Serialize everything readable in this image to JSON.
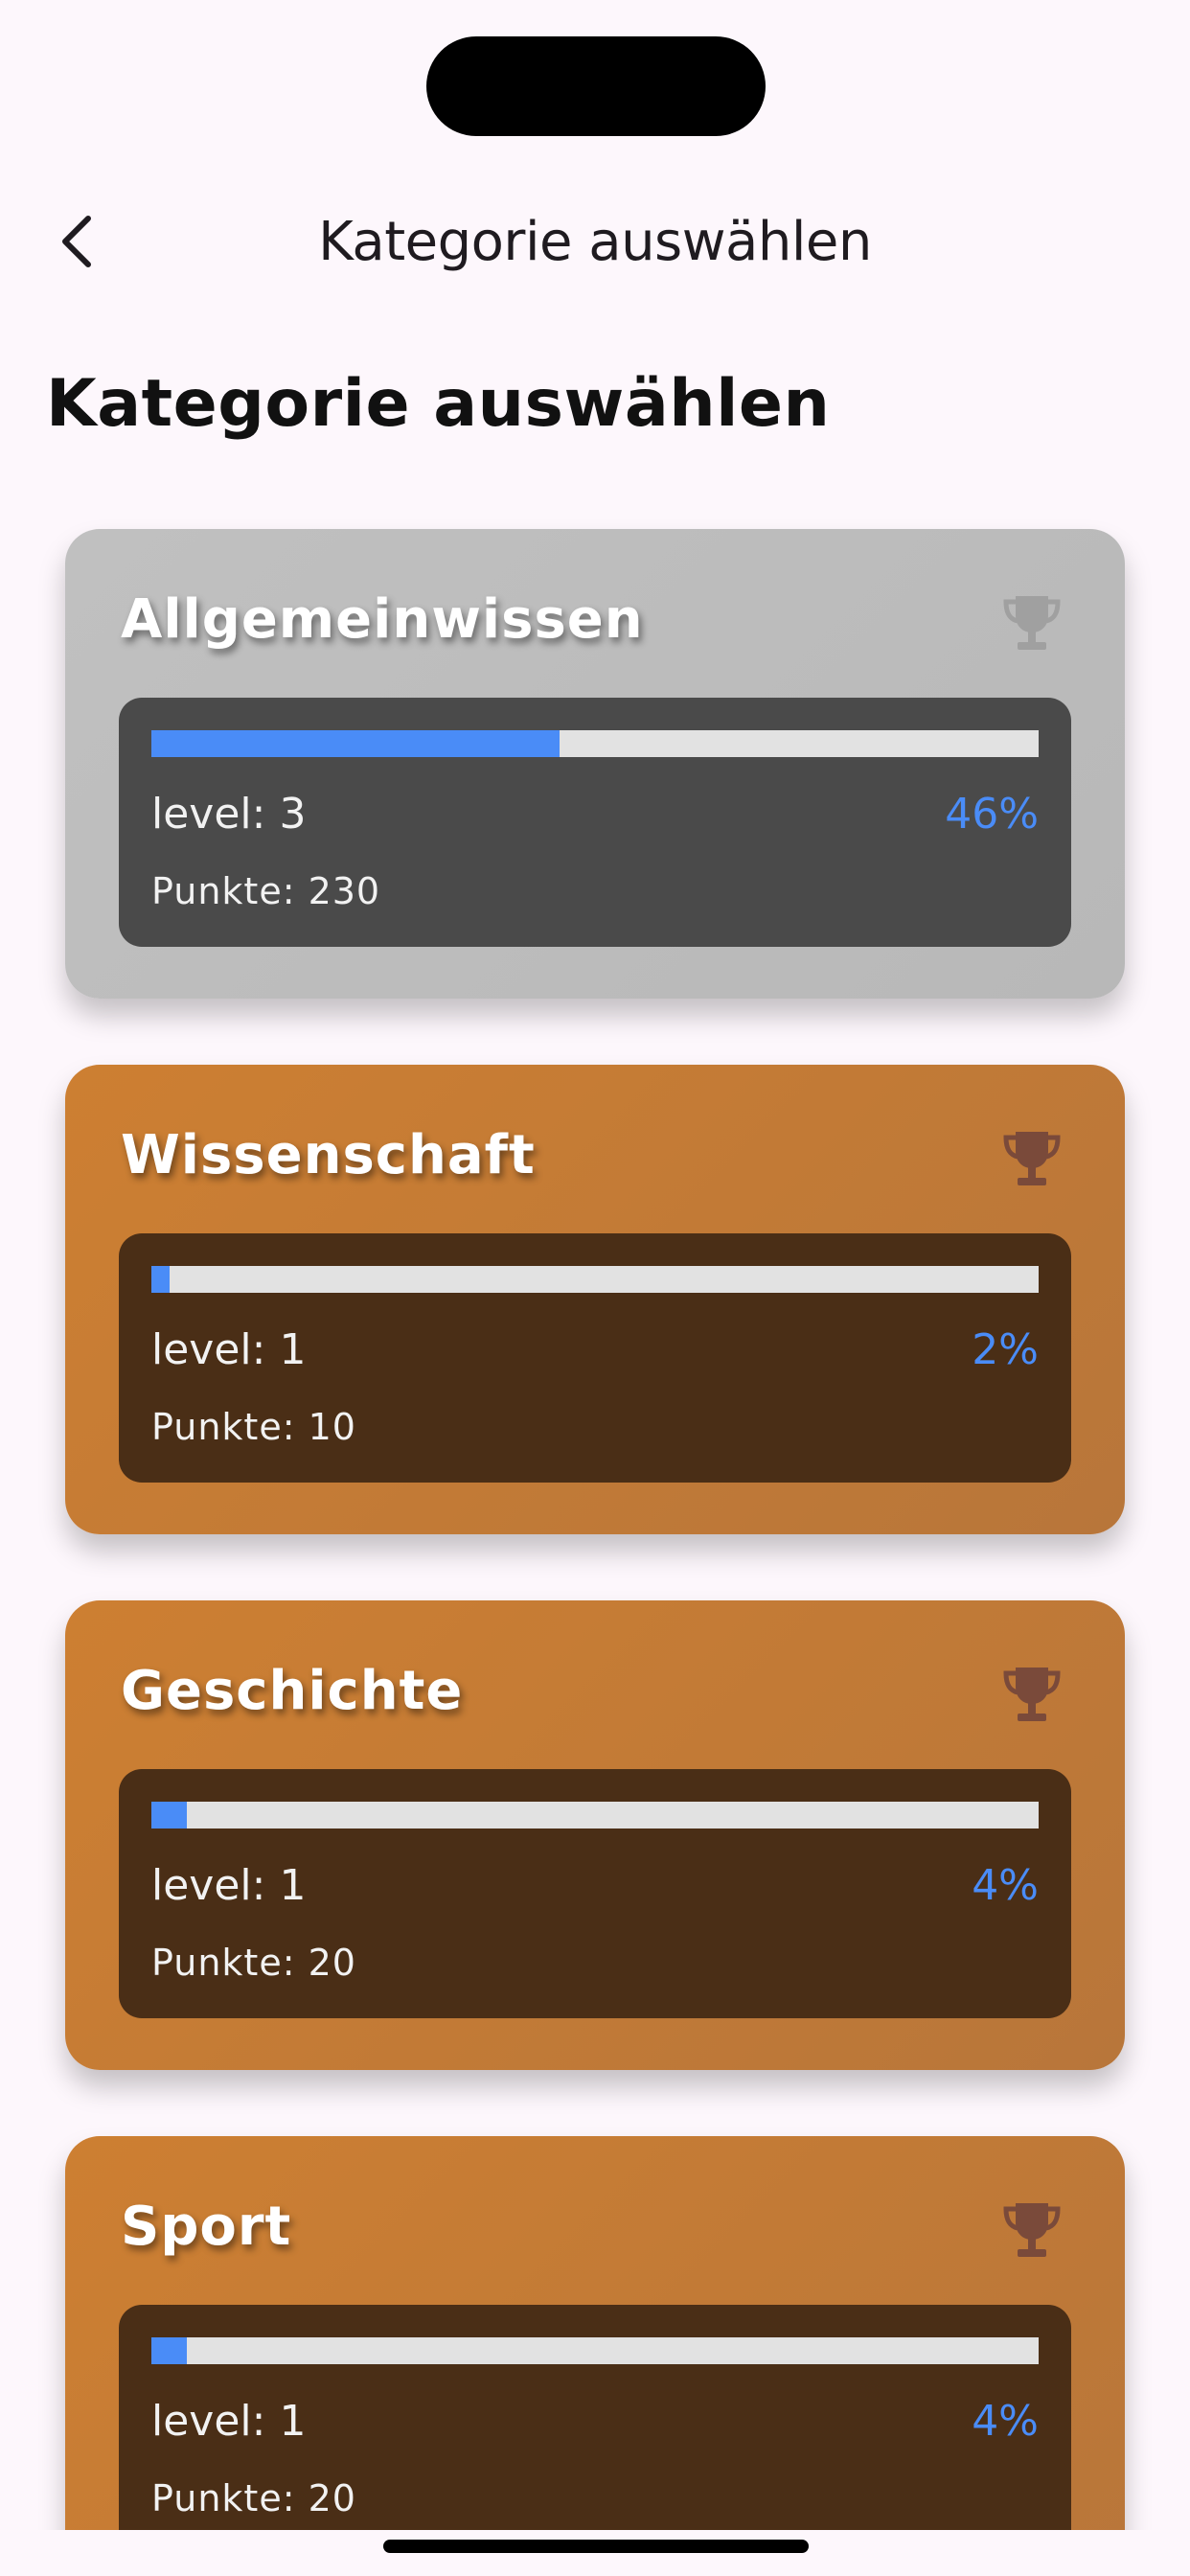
{
  "header": {
    "back_icon": "chevron-left-icon",
    "title": "Kategorie auswählen"
  },
  "page": {
    "title": "Kategorie auswählen"
  },
  "colors": {
    "background": "#fdf7fc",
    "silver_card": "#c0c0c0",
    "bronze_card": "#cd7f32",
    "progress_fill": "#4a8cf7",
    "progress_track": "#e2e2e2"
  },
  "categories": [
    {
      "name": "Allgemeinwissen",
      "tier": "silver",
      "trophy_icon": "trophy-icon",
      "progress": 0.46,
      "level": "level: 3",
      "percent": "46%",
      "points": "Punkte: 230"
    },
    {
      "name": "Wissenschaft",
      "tier": "bronze",
      "trophy_icon": "trophy-icon",
      "progress": 0.02,
      "level": "level: 1",
      "percent": "2%",
      "points": "Punkte: 10"
    },
    {
      "name": "Geschichte",
      "tier": "bronze",
      "trophy_icon": "trophy-icon",
      "progress": 0.04,
      "level": "level: 1",
      "percent": "4%",
      "points": "Punkte: 20"
    },
    {
      "name": "Sport",
      "tier": "bronze",
      "trophy_icon": "trophy-icon",
      "progress": 0.04,
      "level": "level: 1",
      "percent": "4%",
      "points": "Punkte: 20"
    }
  ]
}
